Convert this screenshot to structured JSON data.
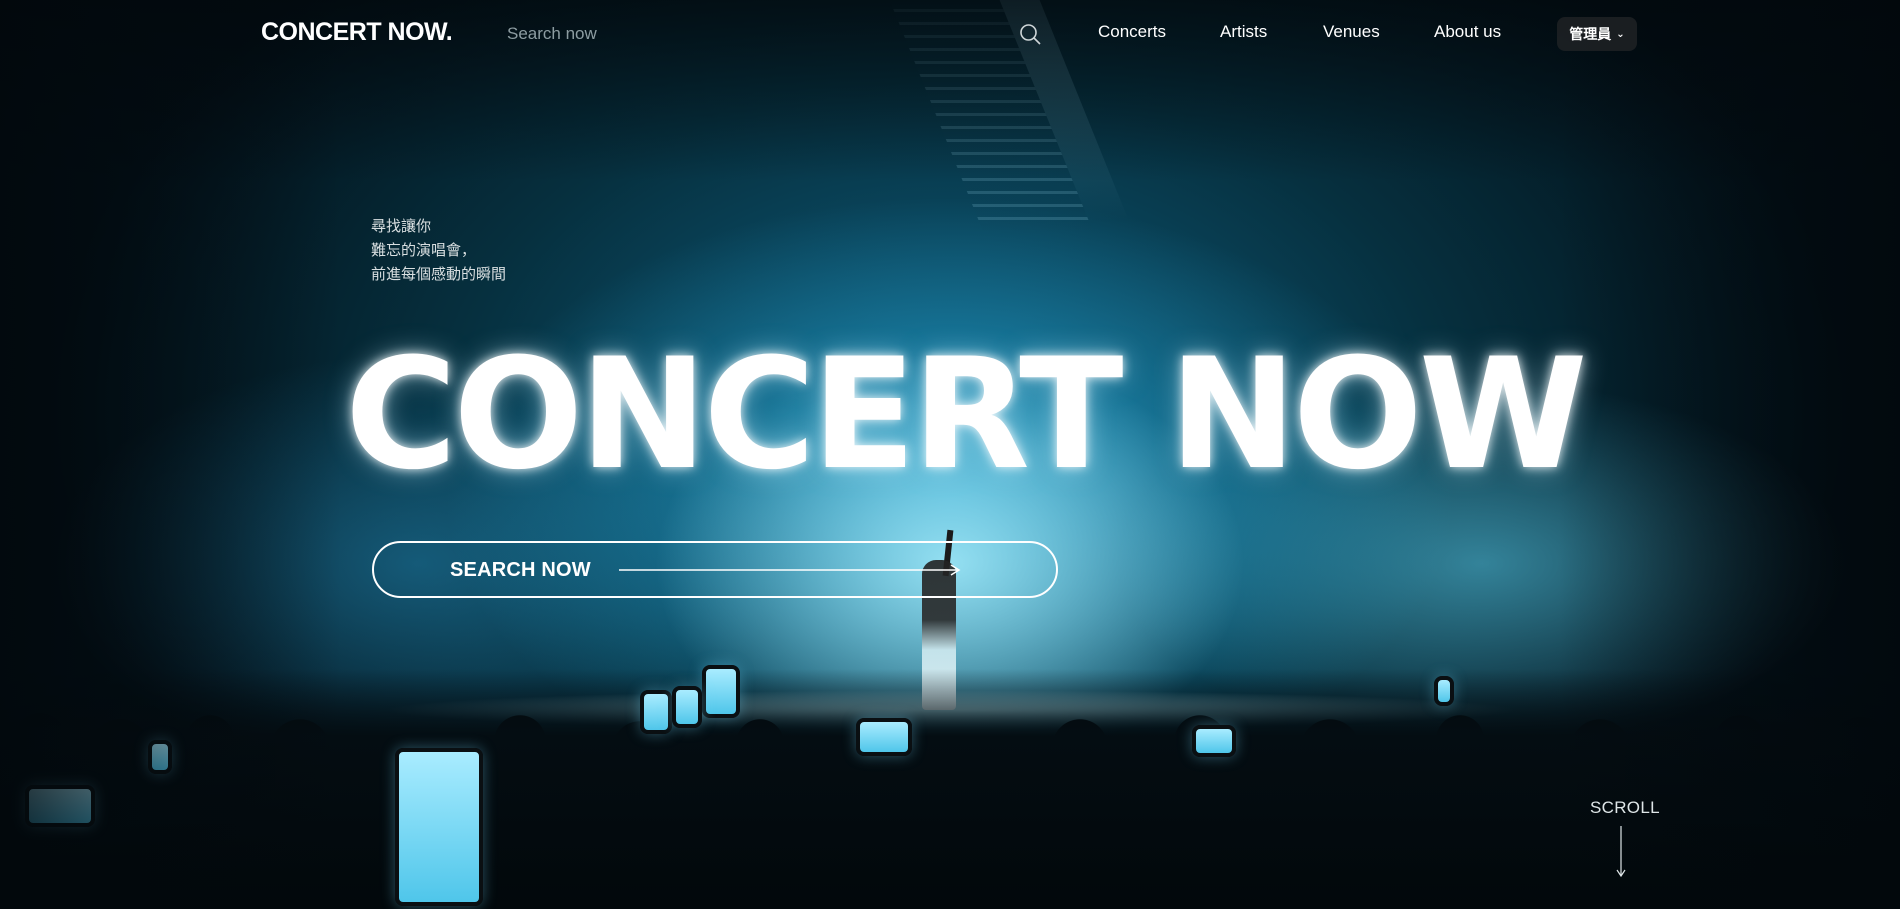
{
  "nav": {
    "logo": "CONCERT NOW.",
    "search_placeholder": "Search now",
    "search_icon": "search-icon",
    "links": [
      "Concerts",
      "Artists",
      "Venues",
      "About us"
    ],
    "admin_label": "管理員"
  },
  "hero": {
    "tagline": [
      "尋找讓你",
      "難忘的演唱會，",
      "前進每個感動的瞬間"
    ],
    "title": "CONCERT NOW",
    "cta_label": "SEARCH NOW"
  },
  "scroll": {
    "label": "SCROLL"
  },
  "colors": {
    "text": "#ffffff",
    "background": "#04131a",
    "glow": "#5fcbe9",
    "admin_bg": "#1e2224"
  }
}
